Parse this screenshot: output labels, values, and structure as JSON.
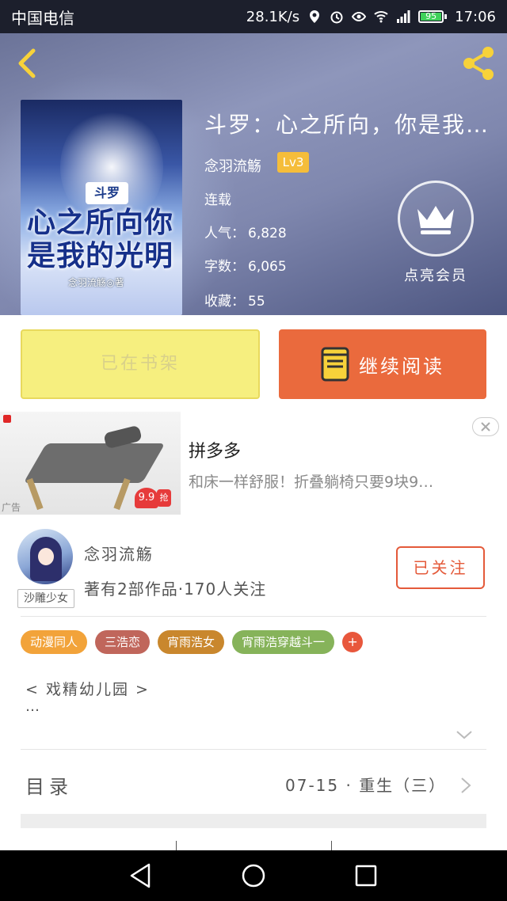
{
  "status_bar": {
    "carrier": "中国电信",
    "speed": "28.1K/s",
    "battery": "95",
    "time": "17:06"
  },
  "book": {
    "title": "斗罗：心之所向，你是我…",
    "author": "念羽流觞",
    "author_level": "Lv3",
    "status": "连载",
    "popularity_label": "人气：",
    "popularity": "6,828",
    "word_count_label": "字数：",
    "word_count": "6,065",
    "favorites_label": "收藏：",
    "favorites": "55",
    "vip_label": "点亮会员",
    "cover": {
      "series": "斗罗",
      "title": "心之所向你是我的光明",
      "author": "念羽流觞◎著"
    }
  },
  "actions": {
    "shelf_label": "已在书架",
    "read_label": "继续阅读"
  },
  "ad": {
    "title": "拼多多",
    "description": "和床一样舒服！折叠躺椅只要9块9…",
    "tag": "广告",
    "price": "9.9",
    "price_suffix": "抢"
  },
  "author_section": {
    "name": "念羽流觞",
    "stats": "著有2部作品·170人关注",
    "avatar_tag": "沙雕少女",
    "follow_label": "已关注"
  },
  "tags": [
    {
      "label": "动漫同人",
      "color": "#f2a33a"
    },
    {
      "label": "三浩恋",
      "color": "#c0665b"
    },
    {
      "label": "宵雨浩女",
      "color": "#c9872d"
    },
    {
      "label": "宵雨浩穿越斗一",
      "color": "#86b35a"
    }
  ],
  "tags_more": "+",
  "synopsis": {
    "line1": "< 戏精幼儿园 >",
    "line2": "…"
  },
  "toc": {
    "label": "目录",
    "latest": "07-15 · 重生（三）"
  },
  "colors": {
    "accent": "#ea6a3d",
    "shelf_bg": "#f6ef7f",
    "level_badge": "#f5bd3a"
  }
}
